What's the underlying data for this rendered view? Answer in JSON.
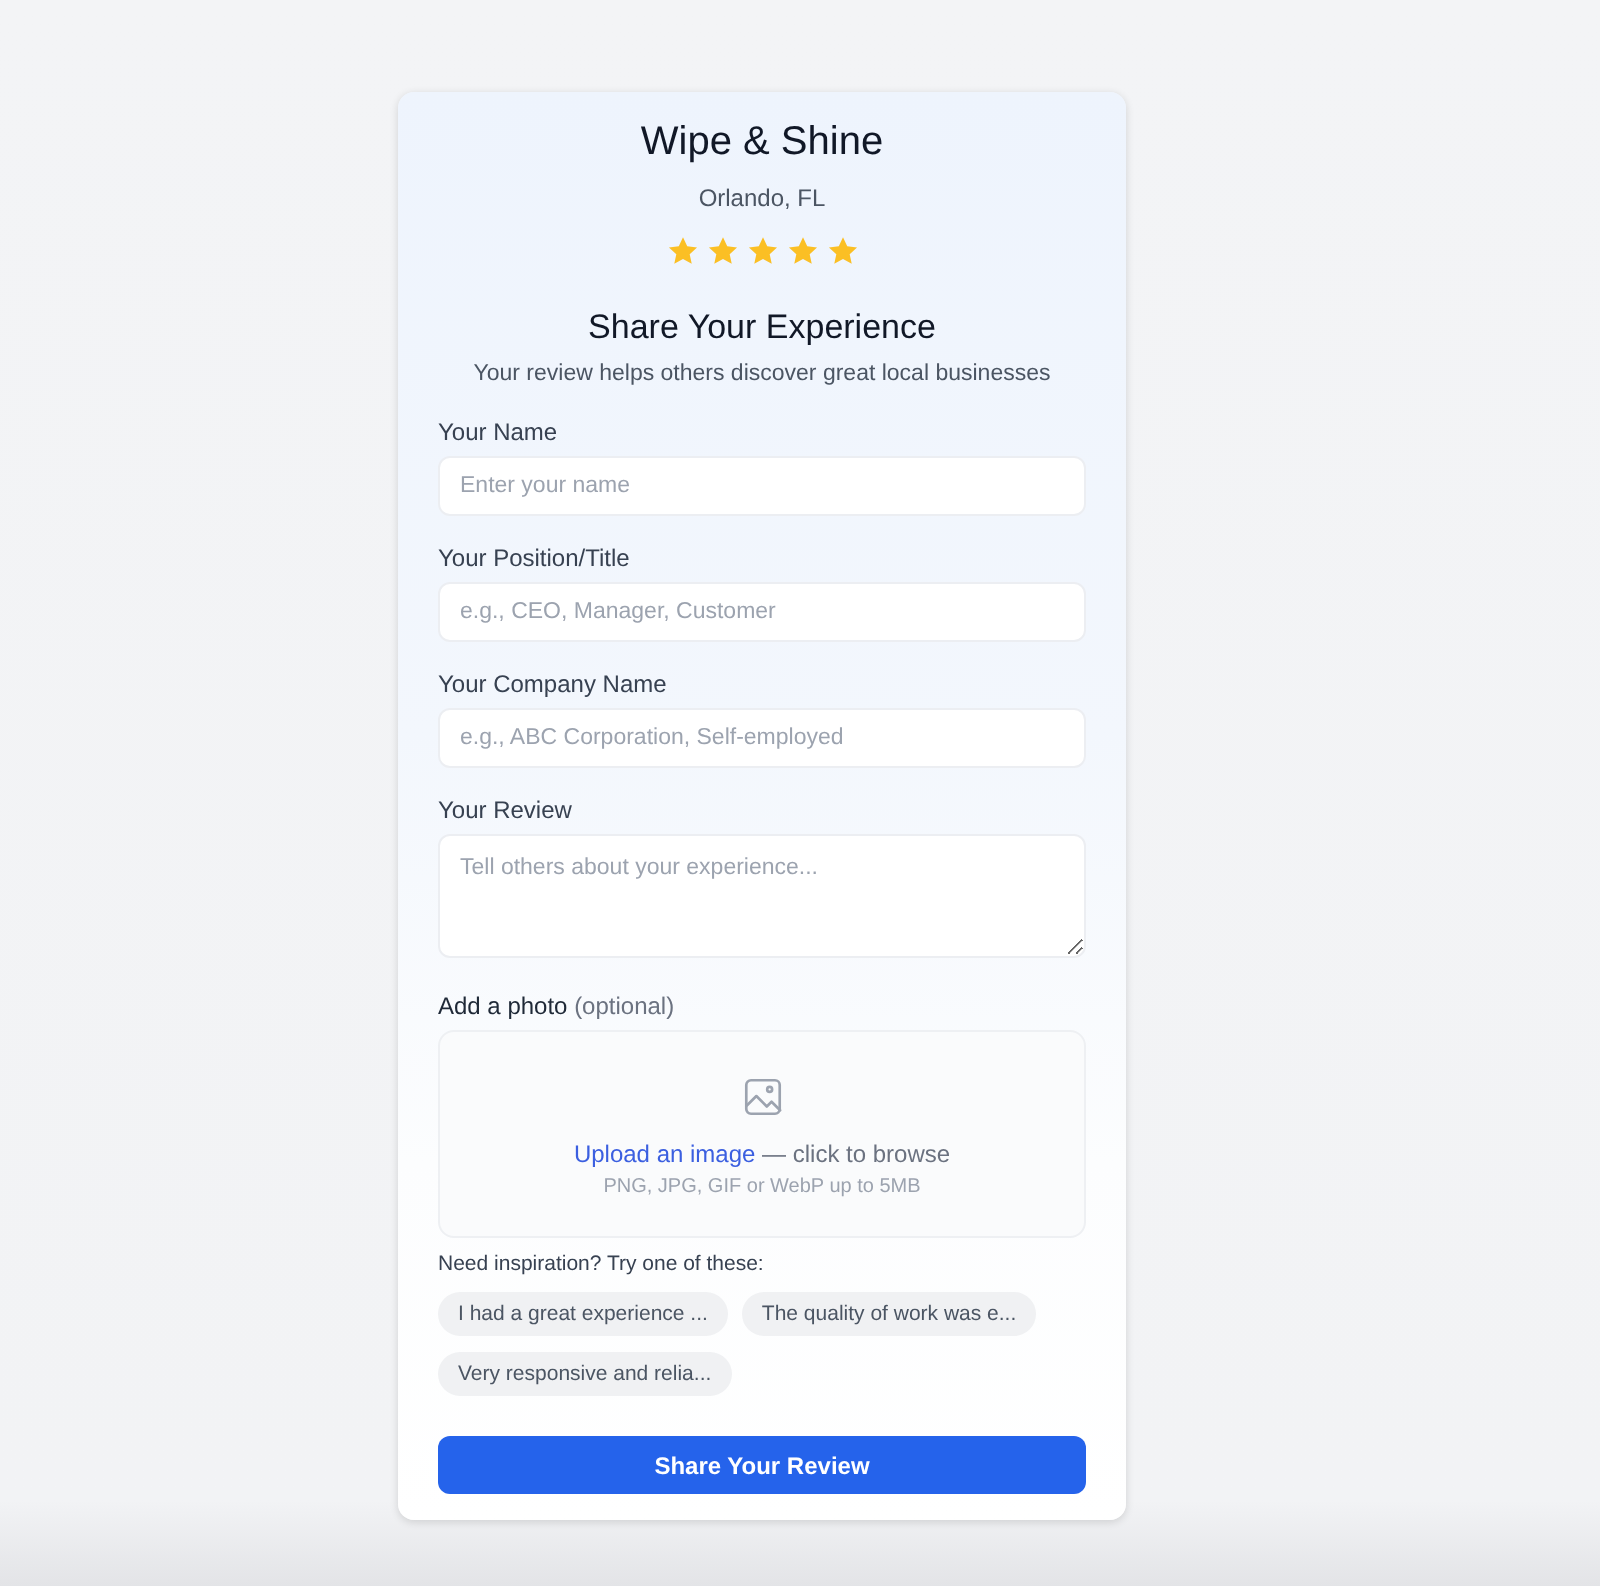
{
  "business": {
    "name": "Wipe & Shine",
    "location": "Orlando, FL",
    "stars": 5
  },
  "intro": {
    "title": "Share Your Experience",
    "subtitle": "Your review helps others discover great local businesses"
  },
  "fields": [
    {
      "kind": "input",
      "label": "Your Name",
      "placeholder": "Enter your name"
    },
    {
      "kind": "input",
      "label": "Your Position/Title",
      "placeholder": "e.g., CEO, Manager, Customer"
    },
    {
      "kind": "input",
      "label": "Your Company Name",
      "placeholder": "e.g., ABC Corporation, Self-employed"
    },
    {
      "kind": "textarea",
      "label": "Your Review",
      "placeholder": "Tell others about your experience..."
    }
  ],
  "photo": {
    "label": "Add a photo",
    "note": "(optional)",
    "link": "Upload an image",
    "action": "— click to browse",
    "hint": "PNG, JPG, GIF or WebP up to 5MB"
  },
  "suggestions": {
    "prompt": "Need inspiration? Try one of these:",
    "chips": [
      "I had a great experience ...",
      "The quality of work was e...",
      "Very responsive and relia..."
    ]
  },
  "submit": "Share Your Review"
}
